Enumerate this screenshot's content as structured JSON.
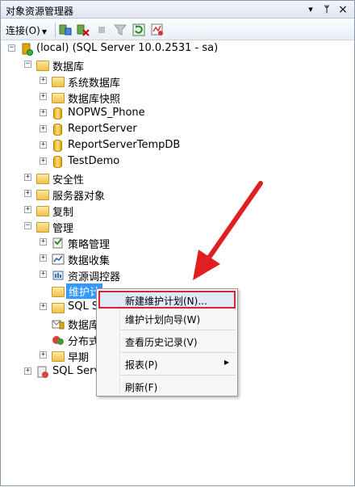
{
  "panel": {
    "title": "对象资源管理器",
    "pin": "ᛘ",
    "close": "×"
  },
  "toolbar": {
    "connect_label": "连接(O)"
  },
  "tree": {
    "server": "(local) (SQL Server 10.0.2531 - sa)",
    "databases": "数据库",
    "sys_db": "系统数据库",
    "snapshots": "数据库快照",
    "db1": "NOPWS_Phone",
    "db2": "ReportServer",
    "db3": "ReportServerTempDB",
    "db4": "TestDemo",
    "security": "安全性",
    "server_objects": "服务器对象",
    "replication": "复制",
    "management": "管理",
    "policy": "策略管理",
    "data_collection": "数据收集",
    "resource_governor": "资源调控器",
    "maintenance_plans": "维护计",
    "sql_s": "SQL S",
    "db_mail": "数据库",
    "dtc": "分布式",
    "legacy": "早期",
    "sql_agent": "SQL Serve"
  },
  "context_menu": {
    "new_plan": "新建维护计划(N)...",
    "wizard": "维护计划向导(W)",
    "history": "查看历史记录(V)",
    "reports": "报表(P)",
    "refresh": "刷新(F)"
  },
  "colors": {
    "highlight_border": "#d8242f",
    "arrow": "#e02020"
  }
}
